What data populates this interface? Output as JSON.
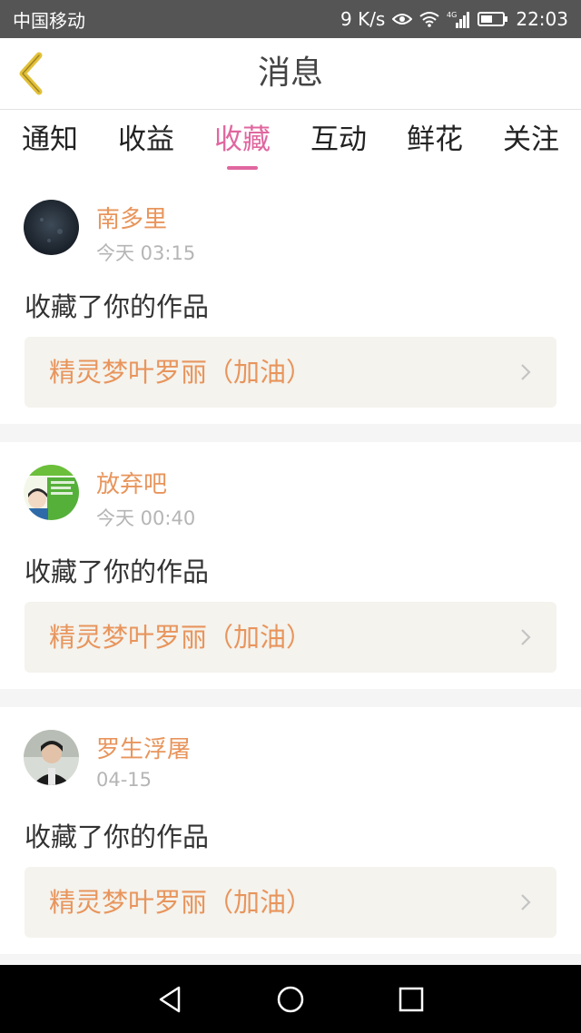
{
  "status_bar": {
    "carrier": "中国移动",
    "net_speed": "9 K/s",
    "time": "22:03",
    "icons": [
      "eye-icon",
      "wifi-icon",
      "signal-4g-icon",
      "battery-icon"
    ]
  },
  "header": {
    "title": "消息",
    "back_icon": "chevron-left-icon"
  },
  "tabs": [
    {
      "label": "通知",
      "active": false
    },
    {
      "label": "收益",
      "active": false
    },
    {
      "label": "收藏",
      "active": true
    },
    {
      "label": "互动",
      "active": false
    },
    {
      "label": "鲜花",
      "active": false
    },
    {
      "label": "关注",
      "active": false
    }
  ],
  "notifications": [
    {
      "username": "南多里",
      "time": "今天 03:15",
      "action": "收藏了你的作品",
      "work_title": "精灵梦叶罗丽（加油）"
    },
    {
      "username": "放弃吧",
      "time": "今天 00:40",
      "action": "收藏了你的作品",
      "work_title": "精灵梦叶罗丽（加油）"
    },
    {
      "username": "罗生浮屠",
      "time": "04-15",
      "action": "收藏了你的作品",
      "work_title": "精灵梦叶罗丽（加油）"
    }
  ],
  "colors": {
    "accent_pink": "#e0679f",
    "orange_text": "#e8955c",
    "back_arrow": "#e3c13a"
  },
  "nav_bar": {
    "icons": [
      "back-triangle-icon",
      "home-circle-icon",
      "recents-square-icon"
    ]
  }
}
